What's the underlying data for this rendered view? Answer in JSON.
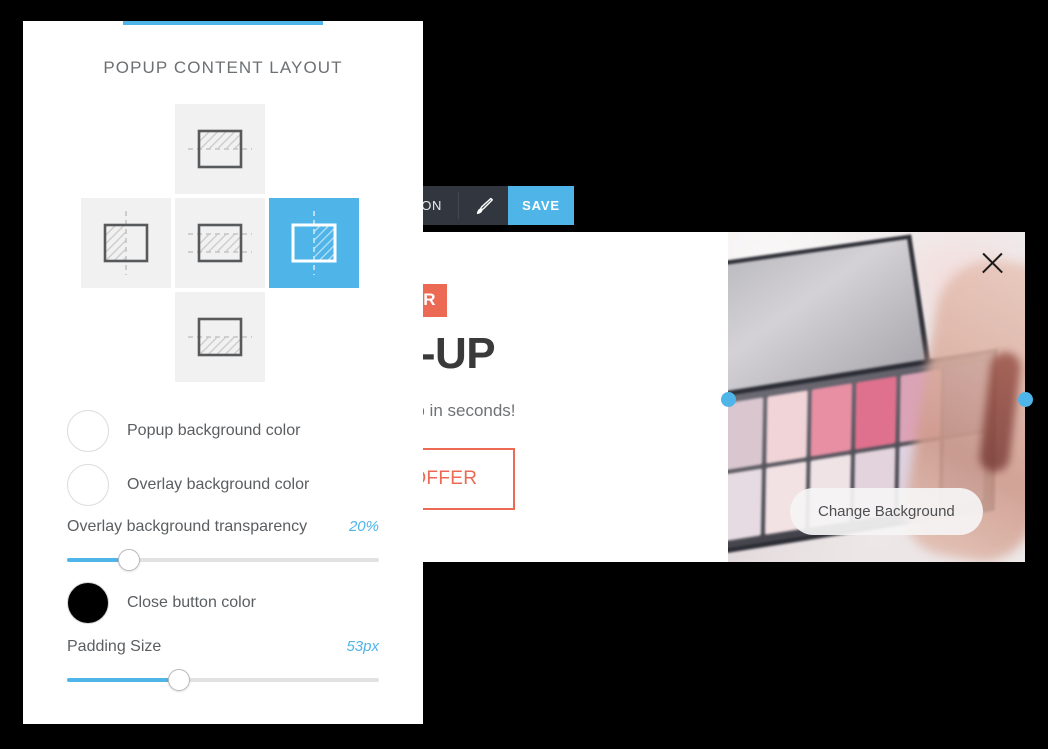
{
  "toolbar": {
    "display_toggle_label": "Y ON",
    "brush_icon": "paintbrush-icon",
    "save_label": "SAVE",
    "accent_color": "#4fb4e8",
    "background_color": "#32363e"
  },
  "popup": {
    "badge_text": "SPECIAL OFFER",
    "headline": "O POP-UP",
    "subheadline": "e your own pop-up in seconds!",
    "cta_label": "GET THE OFFER",
    "cta_color": "#ec6a54",
    "change_background_label": "Change Background",
    "close_icon": "close-x-icon",
    "handle_color": "#4fb4e8"
  },
  "panel": {
    "title": "POPUP CONTENT LAYOUT",
    "tab_indicator_color": "#4fb4e8",
    "layouts": [
      {
        "id": "top",
        "name": "content-top",
        "selected": false
      },
      {
        "id": "left",
        "name": "content-left",
        "selected": false
      },
      {
        "id": "center",
        "name": "content-center",
        "selected": false
      },
      {
        "id": "right",
        "name": "content-right",
        "selected": true
      },
      {
        "id": "bottom",
        "name": "content-bottom",
        "selected": false
      }
    ],
    "colors": [
      {
        "label": "Popup background color",
        "value": "#ffffff",
        "filled": false
      },
      {
        "label": "Overlay background color",
        "value": "#ffffff",
        "filled": false
      }
    ],
    "transparency": {
      "label": "Overlay background transparency",
      "value_text": "20%",
      "percent": 20
    },
    "close_button_color": {
      "label": "Close button color",
      "value": "#000000",
      "filled": true
    },
    "padding": {
      "label": "Padding Size",
      "value_text": "53px",
      "percent": 36
    }
  }
}
